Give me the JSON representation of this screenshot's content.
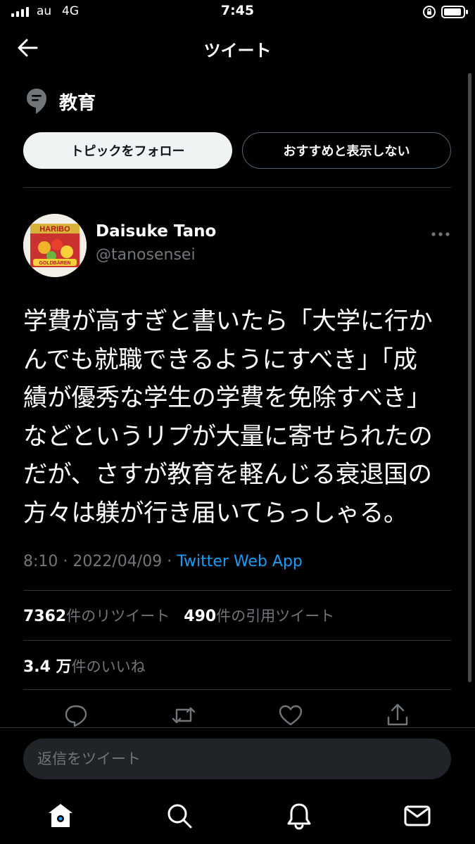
{
  "status_bar": {
    "carrier": "au",
    "network": "4G",
    "time": "7:45"
  },
  "header": {
    "title": "ツイート",
    "back_icon": "arrow-left-icon"
  },
  "topic": {
    "icon": "topic-icon",
    "label": "教育",
    "follow_button": "トピックをフォロー",
    "hide_button": "おすすめと表示しない"
  },
  "tweet": {
    "author_name": "Daisuke Tano",
    "author_handle": "@tanosensei",
    "text": "学費が高すぎと書いたら「大学に行か\nんでも就職できるようにすべき」「成\n績が優秀な学生の学費を免除すべき」\nなどというリプが大量に寄せられたの\nだが、さすが教育を軽んじる衰退国の\n方々は躾が行き届いてらっしゃる。",
    "time": "8:10",
    "date": "2022/04/09",
    "separator": "·",
    "source": "Twitter Web App"
  },
  "stats": {
    "retweets_count": "7362",
    "retweets_label": "件のリツイート",
    "quotes_count": "490",
    "quotes_label": "件の引用ツイート",
    "likes_count": "3.4 万",
    "likes_label": "件のいいね"
  },
  "reply": {
    "placeholder": "返信をツイート"
  },
  "colors": {
    "background": "#000000",
    "accent": "#1d9bf0",
    "muted": "#71767b",
    "divider": "#2f3336"
  },
  "tab_bar": {
    "icons": [
      "home-icon",
      "search-icon",
      "notifications-icon",
      "messages-icon"
    ]
  }
}
